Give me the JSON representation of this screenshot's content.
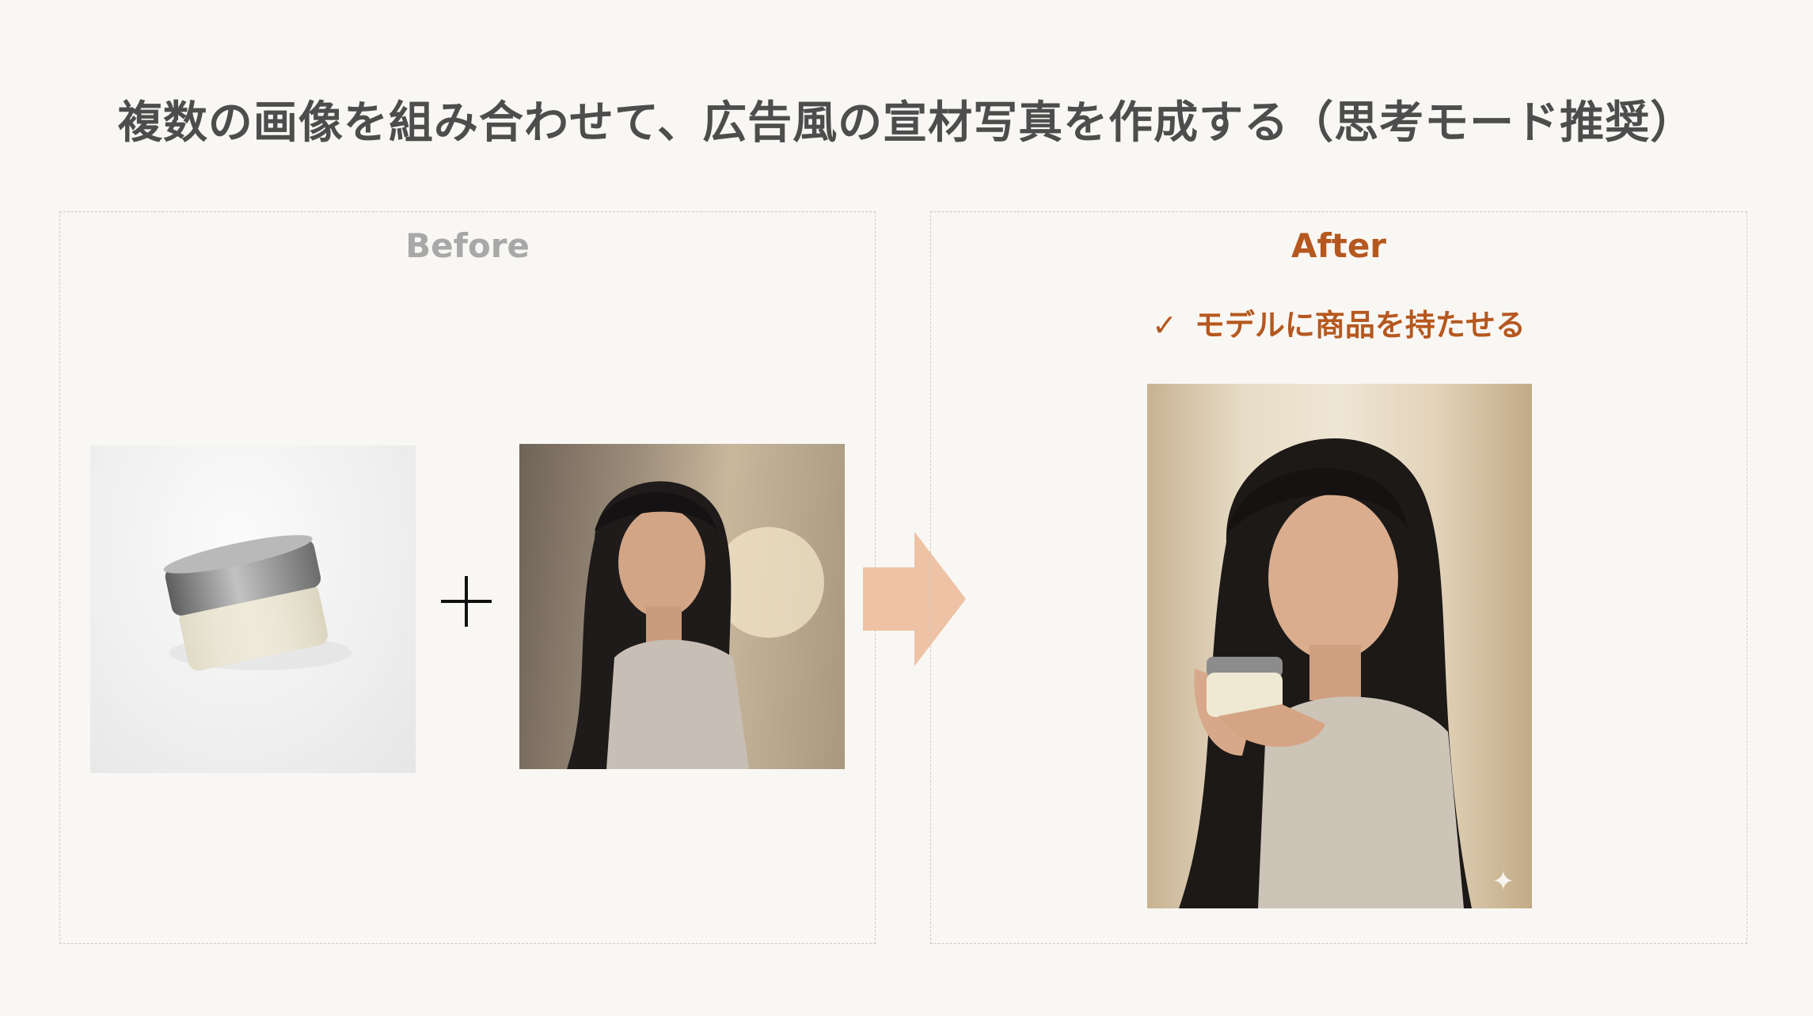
{
  "title": "複数の画像を組み合わせて、広告風の宣材写真を作成する（思考モード推奨）",
  "before": {
    "heading": "Before"
  },
  "after": {
    "heading": "After",
    "checkmark": "✓",
    "check_text": "モデルに商品を持たせる",
    "sparkle": "✦"
  },
  "colors": {
    "background": "#f9f7f3",
    "title": "#4d4d4d",
    "before_heading": "#a8a8a8",
    "accent": "#b5581f",
    "arrow": "#eec2a5"
  },
  "icons": {
    "plus": "plus-icon",
    "arrow": "arrow-right-icon",
    "check": "check-icon",
    "sparkle": "sparkle-icon"
  }
}
